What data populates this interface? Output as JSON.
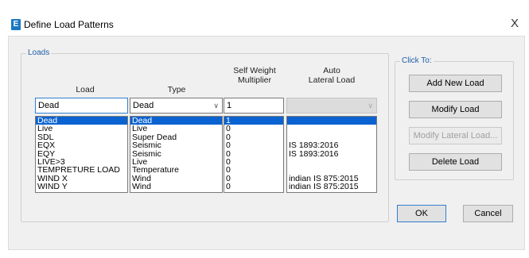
{
  "window": {
    "title": "Define Load Patterns",
    "app_icon_letter": "E",
    "close_glyph": "X"
  },
  "loads_group": {
    "legend": "Loads",
    "headers": {
      "load": "Load",
      "type": "Type",
      "multiplier_line1": "Self Weight",
      "multiplier_line2": "Multiplier",
      "lateral_line1": "Auto",
      "lateral_line2": "Lateral Load"
    },
    "inputs": {
      "load_name": "Dead",
      "type_selected": "Dead",
      "multiplier": "1",
      "lateral_selected": ""
    },
    "rows": [
      {
        "load": "Dead",
        "type": "Dead",
        "multiplier": "1",
        "lateral": ""
      },
      {
        "load": "Live",
        "type": "Live",
        "multiplier": "0",
        "lateral": ""
      },
      {
        "load": "SDL",
        "type": "Super Dead",
        "multiplier": "0",
        "lateral": ""
      },
      {
        "load": "EQX",
        "type": "Seismic",
        "multiplier": "0",
        "lateral": "IS 1893:2016"
      },
      {
        "load": "EQY",
        "type": "Seismic",
        "multiplier": "0",
        "lateral": "IS 1893:2016"
      },
      {
        "load": "LIVE>3",
        "type": "Live",
        "multiplier": "0",
        "lateral": ""
      },
      {
        "load": "TEMPRETURE LOAD",
        "type": "Temperature",
        "multiplier": "0",
        "lateral": ""
      },
      {
        "load": "WIND X",
        "type": "Wind",
        "multiplier": "0",
        "lateral": "indian IS 875:2015"
      },
      {
        "load": "WIND Y",
        "type": "Wind",
        "multiplier": "0",
        "lateral": "indian IS 875:2015"
      }
    ]
  },
  "click_to_group": {
    "legend": "Click To:",
    "add_new_load": "Add New Load",
    "modify_load": "Modify Load",
    "modify_lateral_load": "Modify Lateral Load...",
    "delete_load": "Delete Load"
  },
  "footer": {
    "ok": "OK",
    "cancel": "Cancel"
  },
  "colors": {
    "selection": "#0a63d1",
    "legend_text": "#1f5fa8",
    "focus_border": "#2f7fd0"
  }
}
